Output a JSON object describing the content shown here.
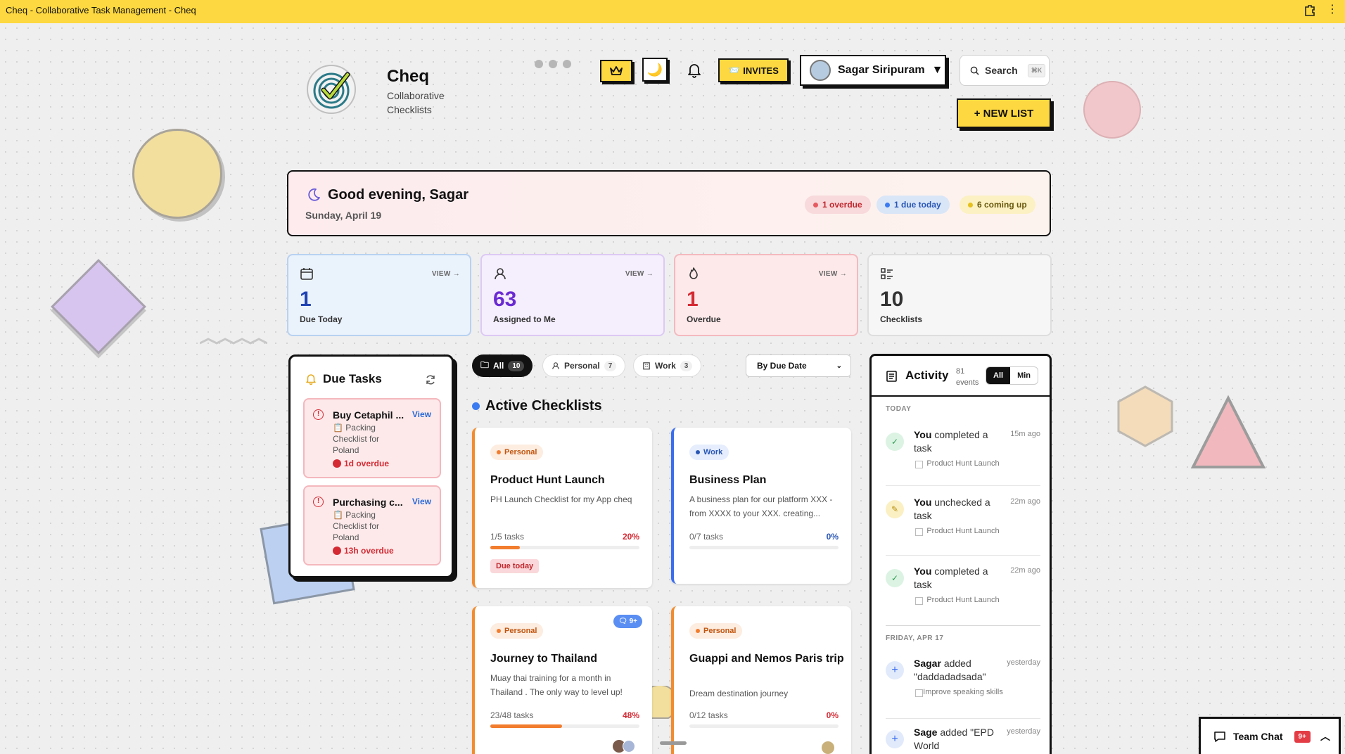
{
  "window": {
    "title": "Cheq - Collaborative Task Management - Cheq"
  },
  "brand": {
    "name": "Cheq",
    "subtitle": "Collaborative Checklists"
  },
  "header": {
    "invites_label": "INVITES",
    "user_name": "Sagar Siripuram",
    "search_label": "Search",
    "search_shortcut": "⌘K",
    "new_list_label": "+ NEW LIST"
  },
  "greeting": {
    "title": "Good evening, Sagar",
    "date": "Sunday, April 19",
    "overdue": "1 overdue",
    "due_today": "1 due today",
    "coming_up": "6 coming up"
  },
  "stats": [
    {
      "value": "1",
      "label": "Due Today",
      "view": "VIEW →"
    },
    {
      "value": "63",
      "label": "Assigned to Me",
      "view": "VIEW →"
    },
    {
      "value": "1",
      "label": "Overdue",
      "view": "VIEW →"
    },
    {
      "value": "10",
      "label": "Checklists"
    }
  ],
  "due_tasks": {
    "title": "Due Tasks",
    "items": [
      {
        "title": "Buy Cetaphil ...",
        "list": "📋 Packing Checklist for Poland",
        "overdue": "1d overdue",
        "view": "View"
      },
      {
        "title": "Purchasing c...",
        "list": "📋 Packing Checklist for Poland",
        "overdue": "13h overdue",
        "view": "View"
      }
    ]
  },
  "filters": {
    "all": {
      "label": "All",
      "count": "10"
    },
    "personal": {
      "label": "Personal",
      "count": "7"
    },
    "work": {
      "label": "Work",
      "count": "3"
    },
    "sort": "By Due Date"
  },
  "section_title": "Active Checklists",
  "checklists": [
    {
      "tag": "Personal",
      "title": "Product Hunt Launch",
      "desc": "PH Launch Checklist for my App cheq",
      "tasks": "1/5 tasks",
      "pct": "20%",
      "progress": 20,
      "badge": "Due today"
    },
    {
      "tag": "Work",
      "title": "Business Plan",
      "desc": "A business plan for our platform XXX - from XXXX to your XXX. creating...",
      "tasks": "0/7 tasks",
      "pct": "0%",
      "progress": 0
    },
    {
      "tag": "Personal",
      "title": "Journey to Thailand",
      "desc": "Muay thai training for a month in Thailand . The only way to level up!",
      "tasks": "23/48 tasks",
      "pct": "48%",
      "progress": 48,
      "chat": "9+"
    },
    {
      "tag": "Personal",
      "title": "Guappi and Nemos Paris trip",
      "desc": "Dream destination journey",
      "tasks": "0/12 tasks",
      "pct": "0%",
      "progress": 0
    }
  ],
  "activity": {
    "title": "Activity",
    "events": "81 events",
    "toggle_all": "All",
    "toggle_min": "Min",
    "today_label": "TODAY",
    "friday_label": "FRIDAY, APR 17",
    "items": [
      {
        "who": "You",
        "action": "completed a task",
        "time": "15m ago",
        "ref": "Product Hunt Launch"
      },
      {
        "who": "You",
        "action": "unchecked a task",
        "time": "22m ago",
        "ref": "Product Hunt Launch"
      },
      {
        "who": "You",
        "action": "completed a task",
        "time": "22m ago",
        "ref": "Product Hunt Launch"
      },
      {
        "who": "Sagar",
        "action": "added \"daddadadsada\"",
        "time": "yesterday",
        "ref": "Improve speaking skills"
      },
      {
        "who": "Sage",
        "action": "added \"EPD World",
        "time": "yesterday"
      }
    ]
  },
  "team_chat": {
    "label": "Team Chat",
    "badge": "9+"
  },
  "colors": {
    "accent": "#fdd840",
    "overdue": "#d42a33",
    "work": "#3a6df0",
    "personal": "#f27d2e"
  }
}
